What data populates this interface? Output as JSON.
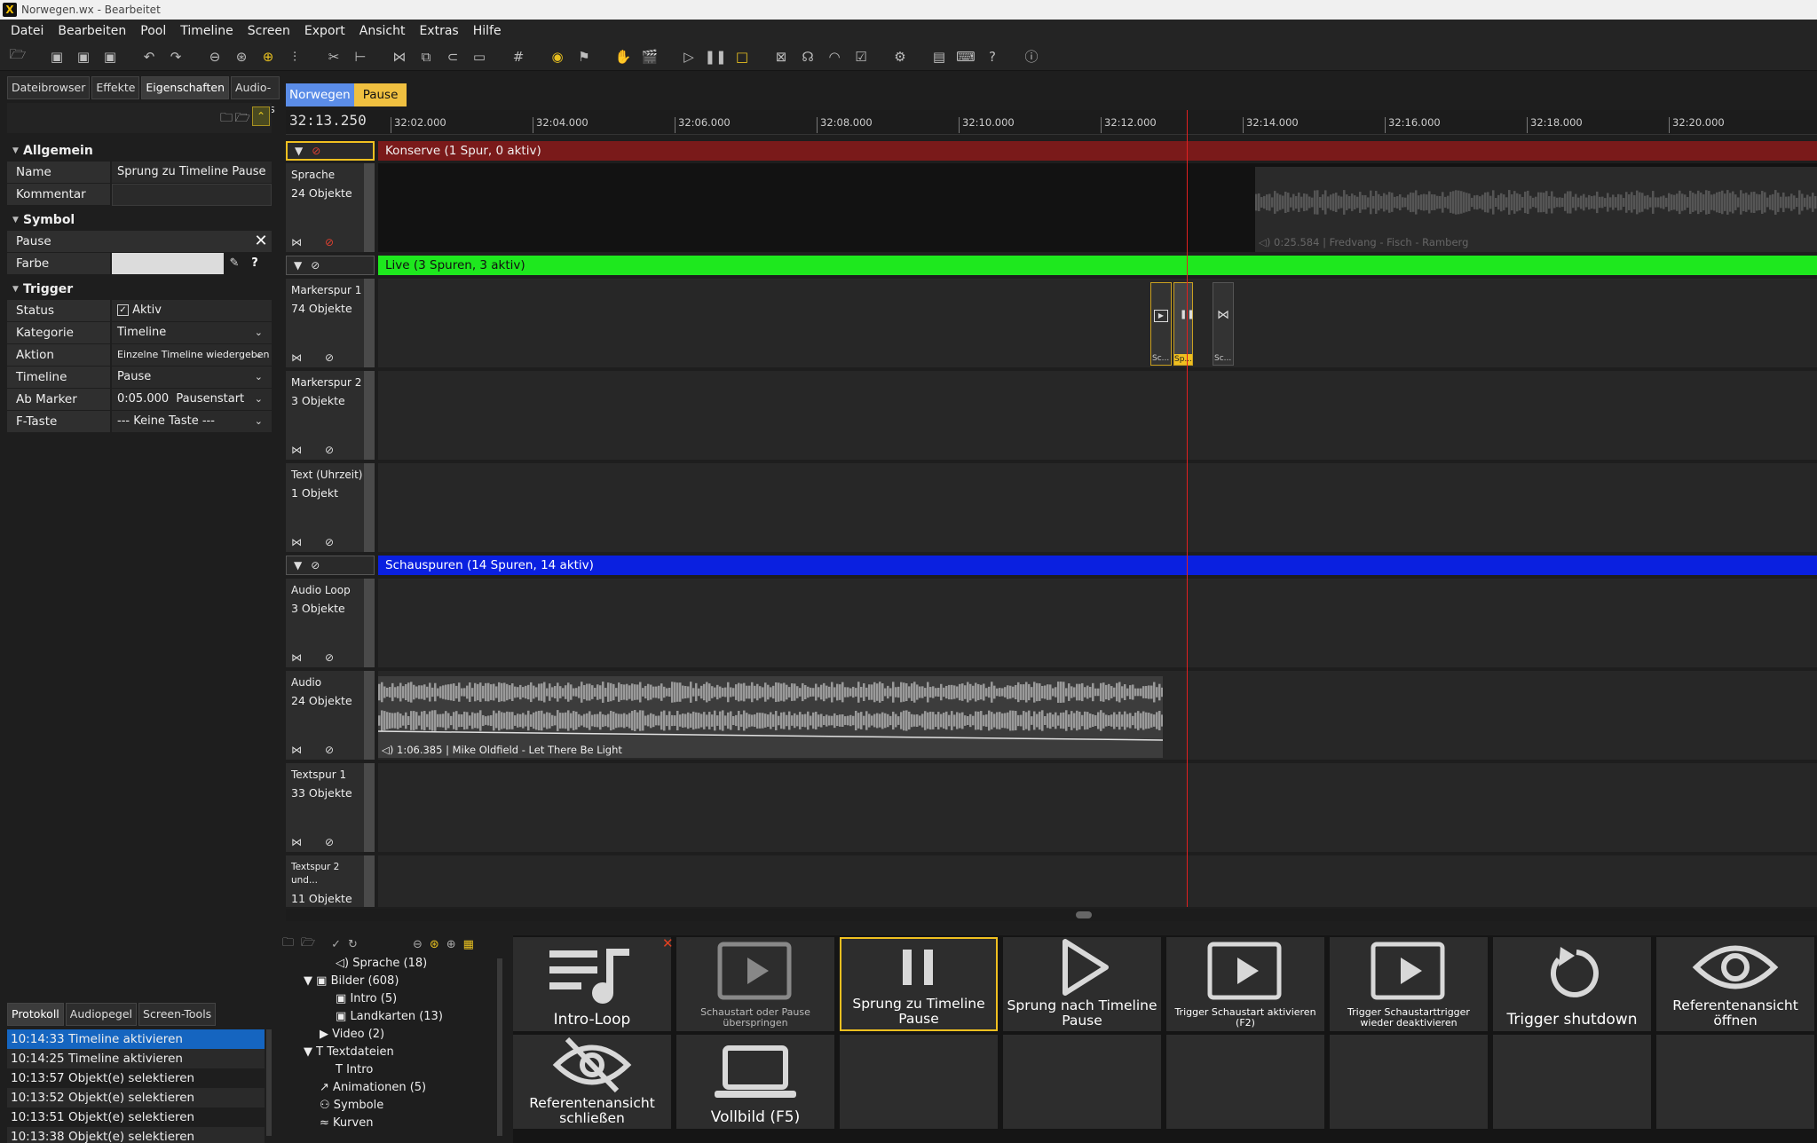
{
  "window": {
    "title": "Norwegen.wx - Bearbeitet"
  },
  "menu": [
    "Datei",
    "Bearbeiten",
    "Pool",
    "Timeline",
    "Screen",
    "Export",
    "Ansicht",
    "Extras",
    "Hilfe"
  ],
  "left_tabs": [
    "Dateibrowser",
    "Effekte",
    "Eigenschaften",
    "Audio-Plugins"
  ],
  "properties": {
    "sec_general": "Allgemein",
    "name_label": "Name",
    "name_value": "Sprung zu Timeline Pause",
    "comment_label": "Kommentar",
    "comment_value": "",
    "sec_symbol": "Symbol",
    "pause_label": "Pause",
    "color_label": "Farbe",
    "color_value": "#dcdcdc",
    "sec_trigger": "Trigger",
    "status_label": "Status",
    "status_value": "Aktiv",
    "category_label": "Kategorie",
    "category_value": "Timeline",
    "action_label": "Aktion",
    "action_value": "Einzelne Timeline wiedergeben",
    "timeline_label": "Timeline",
    "timeline_value": "Pause",
    "marker_label": "Ab Marker",
    "marker_value": "0:05.000  Pausenstart",
    "fkey_label": "F-Taste",
    "fkey_value": "--- Keine Taste ---"
  },
  "bottom_left_tabs": [
    "Protokoll",
    "Audiopegel",
    "Screen-Tools"
  ],
  "protocol": [
    {
      "time": "10:14:33",
      "text": "Timeline aktivieren"
    },
    {
      "time": "10:14:25",
      "text": "Timeline aktivieren"
    },
    {
      "time": "10:13:57",
      "text": "Objekt(e) selektieren"
    },
    {
      "time": "10:13:52",
      "text": "Objekt(e) selektieren"
    },
    {
      "time": "10:13:51",
      "text": "Objekt(e) selektieren"
    },
    {
      "time": "10:13:38",
      "text": "Objekt(e) selektieren"
    }
  ],
  "timeline": {
    "tabs": [
      "Norwegen",
      "Pause"
    ],
    "timecode": "32:13.250",
    "ticks": [
      "32:02.000",
      "32:04.000",
      "32:06.000",
      "32:08.000",
      "32:10.000",
      "32:12.000",
      "32:14.000",
      "32:16.000",
      "32:18.000",
      "32:20.000"
    ],
    "groups": {
      "konserve": "Konserve  (1 Spur, 0 aktiv)",
      "live": "Live  (3 Spuren, 3 aktiv)",
      "schau": "Schauspuren  (14 Spuren, 14 aktiv)"
    },
    "tracks": [
      {
        "name": "Sprache",
        "count": "24 Objekte"
      },
      {
        "name": "Markerspur 1",
        "count": "74 Objekte"
      },
      {
        "name": "Markerspur 2",
        "count": "3 Objekte"
      },
      {
        "name": "Text (Uhrzeit)",
        "count": "1 Objekt"
      },
      {
        "name": "Audio Loop",
        "count": "3 Objekte"
      },
      {
        "name": "Audio",
        "count": "24 Objekte"
      },
      {
        "name": "Textspur 1",
        "count": "33 Objekte"
      },
      {
        "name": "Textspur 2 und...",
        "count": "11 Objekte"
      }
    ],
    "clip_sprache": "0:25.584 | Fredvang - Fisch - Ramberg",
    "clip_audio": "1:06.385 | Mike Oldfield - Let There Be Light",
    "marker_labels": [
      "Sc...",
      "Sp...",
      "Sc..."
    ]
  },
  "library": [
    {
      "label": "Sprache (18)",
      "indent": 3
    },
    {
      "label": "Bilder (608)",
      "indent": 1
    },
    {
      "label": "Intro (5)",
      "indent": 3
    },
    {
      "label": "Landkarten (13)",
      "indent": 3
    },
    {
      "label": "Video (2)",
      "indent": 2
    },
    {
      "label": "Textdateien",
      "indent": 1
    },
    {
      "label": "Intro",
      "indent": 3
    },
    {
      "label": "Animationen (5)",
      "indent": 2
    },
    {
      "label": "Symbole",
      "indent": 2
    },
    {
      "label": "Kurven",
      "indent": 2
    }
  ],
  "buttons": [
    {
      "label": "Intro-Loop",
      "icon": "music-list-icon"
    },
    {
      "label": "Schaustart oder Pause überspringen",
      "icon": "play-box-icon"
    },
    {
      "label": "Sprung zu Timeline Pause",
      "icon": "pause-icon"
    },
    {
      "label": "Sprung nach Timeline Pause",
      "icon": "play-icon"
    },
    {
      "label": "Trigger Schaustart aktivieren (F2)",
      "icon": "play-box-icon"
    },
    {
      "label": "Trigger Schaustarttrigger wieder deaktivieren",
      "icon": "play-box-icon"
    },
    {
      "label": "Trigger shutdown",
      "icon": "restart-icon"
    },
    {
      "label": "Referentenansicht öffnen",
      "icon": "eye-icon"
    },
    {
      "label": "Referentenansicht schließen",
      "icon": "eye-off-icon"
    },
    {
      "label": "Vollbild (F5)",
      "icon": "laptop-icon"
    }
  ]
}
